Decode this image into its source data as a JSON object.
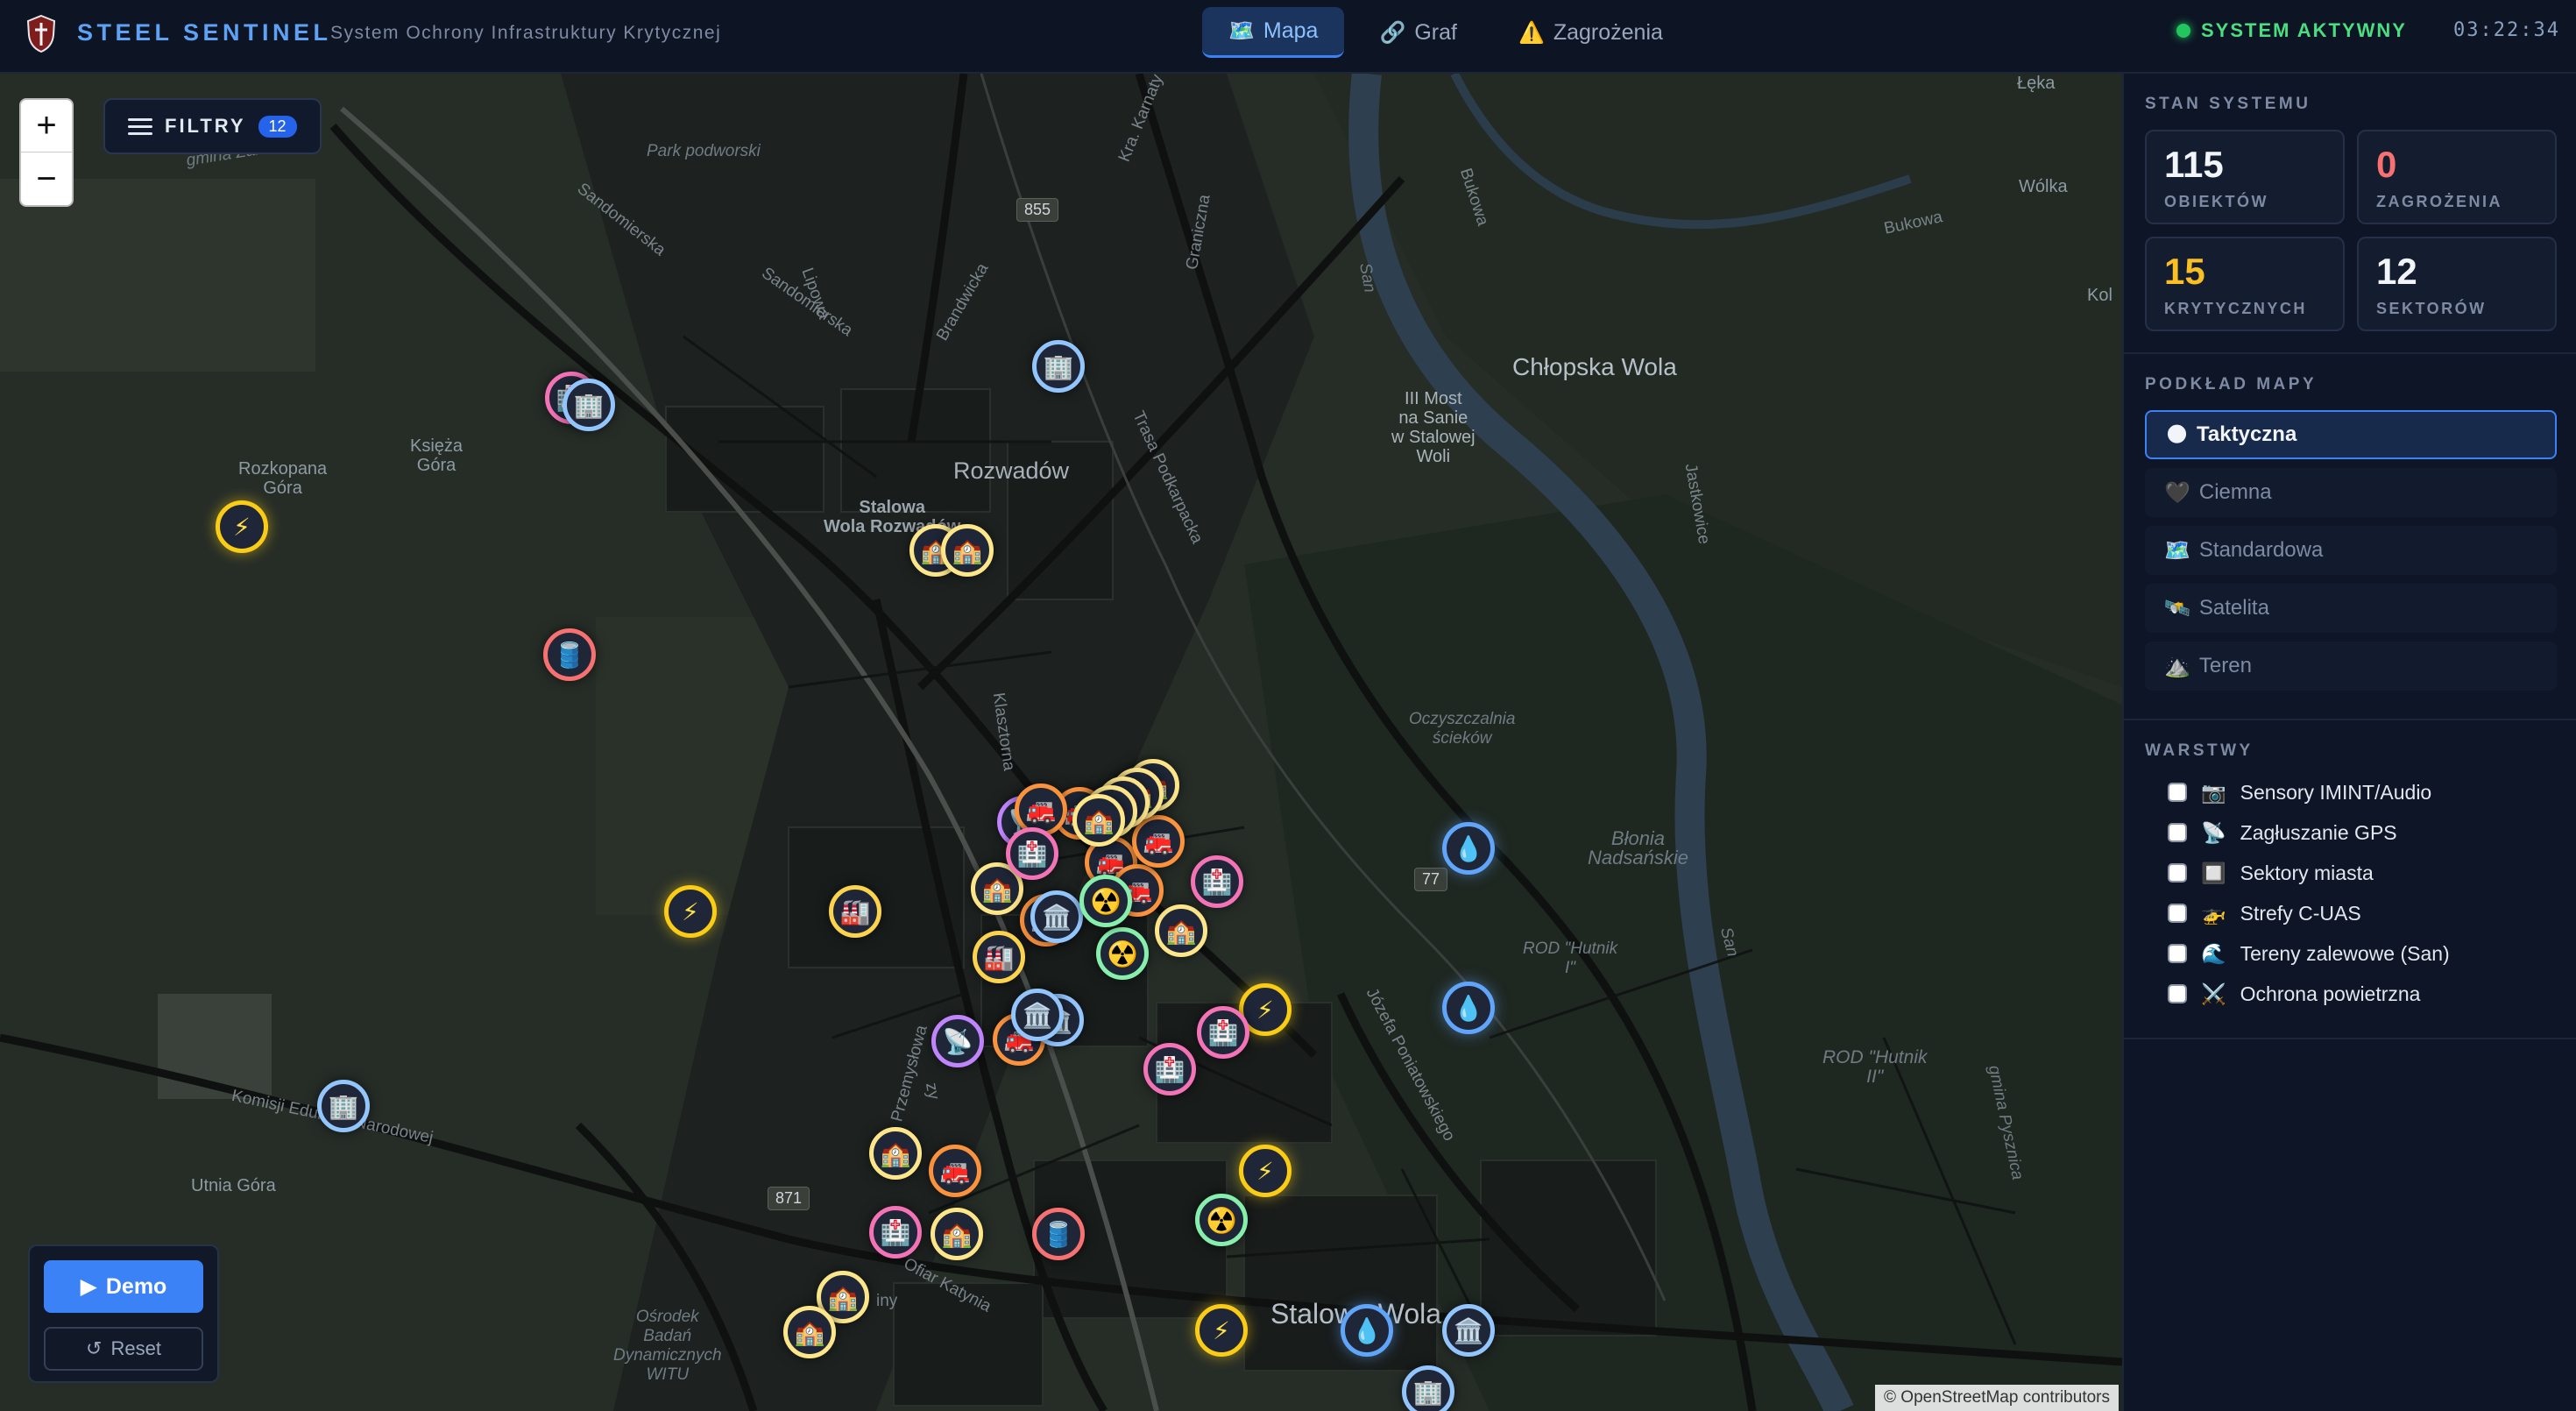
{
  "header": {
    "brand": "STEEL SENTINEL",
    "tagline": "System Ochrony Infrastruktury Krytycznej",
    "tabs": [
      {
        "icon": "🗺️",
        "label": "Mapa",
        "active": true
      },
      {
        "icon": "🔗",
        "label": "Graf",
        "active": false
      },
      {
        "icon": "⚠️",
        "label": "Zagrożenia",
        "active": false
      }
    ],
    "status_label": "SYSTEM AKTYWNY",
    "status_color": "#22c55e",
    "clock": "03:22:34"
  },
  "map": {
    "filters_label": "FILTRY",
    "filters_count": "12",
    "zoom_in": "+",
    "zoom_out": "−",
    "demo_label": "Demo",
    "demo_icon": "▶",
    "reset_label": "Reset",
    "reset_icon": "↺",
    "attribution": "© OpenStreetMap contributors",
    "labels": {
      "park": "Park podworski",
      "zaleszany": "gmina Zaleszany",
      "sandomierska1": "Sandomierska",
      "sandomierska2": "Sandomierska",
      "lipowa": "Lipowa",
      "brandwicka": "Brandwicka",
      "graniczna": "Graniczna",
      "krakowska": "Kra. Karnaty",
      "rozkopana": "Rozkopana\nGóra",
      "ksieza": "Księża\nGóra",
      "rozwadow": "Rozwadów",
      "stalowa_rozwadow": "Stalowa\nWola Rozwadów",
      "trasa": "Trasa Podkarpacka",
      "most": "III Most\nna Sanie\nw Stalowej\nWoli",
      "chlopska": "Chłopska Wola",
      "leka": "Łęka",
      "wolka": "Wólka",
      "bukowa": "Bukowa",
      "bukowa2": "Bukowa",
      "kol": "Kol",
      "san1": "San",
      "san2": "San",
      "jastkowice": "Jastkowice",
      "oczyszczalnia": "Oczyszczalnia\nścieków",
      "blonia": "Błonia\nNadsańskie",
      "rod_hutnik1": "ROD \"Hutnik\nI\"",
      "rod_hutnik2": "ROD \"Hutnik\nII\"",
      "gmina_pysznica": "gmina Pysznica",
      "klasztorna": "Klasztorna",
      "komisji": "Komisji Edukacji Narodowej",
      "utnia": "Utnia Góra",
      "przemyslowa": "Przemysłowa",
      "poniatowskiego": "Józefa Poniatowskiego",
      "osrodek": "Ośrodek\nBadań\nDynamicznych\nWITU",
      "stalowa_wola": "Stalowa Wola",
      "kar_katyn": "Ofiar Katynia",
      "zy": "zy",
      "ny": "iny"
    },
    "shields": {
      "r855": "855",
      "r77": "77",
      "r871": "871"
    },
    "markers": [
      {
        "type": "power",
        "icon": "⚡"
      },
      {
        "type": "fuel",
        "icon": "🛢️"
      },
      {
        "type": "power",
        "icon": "⚡"
      },
      {
        "type": "gov",
        "icon": "🏢"
      },
      {
        "type": "med",
        "icon": "🏥"
      },
      {
        "type": "gov",
        "icon": "🏢"
      },
      {
        "type": "gov",
        "icon": "🏢"
      },
      {
        "type": "ind",
        "icon": "🏭"
      },
      {
        "type": "water",
        "icon": "💧"
      },
      {
        "type": "water",
        "icon": "💧"
      },
      {
        "type": "power",
        "icon": "⚡"
      },
      {
        "type": "power",
        "icon": "⚡"
      },
      {
        "type": "power",
        "icon": "⚡"
      },
      {
        "type": "water",
        "icon": "💧"
      },
      {
        "type": "gov",
        "icon": "🏛️"
      },
      {
        "type": "gov",
        "icon": "🏢"
      },
      {
        "type": "comm",
        "icon": "📡"
      },
      {
        "type": "fire",
        "icon": "🚒"
      },
      {
        "type": "med",
        "icon": "🏥"
      },
      {
        "type": "med",
        "icon": "🏥"
      },
      {
        "type": "chem",
        "icon": "☢️"
      },
      {
        "type": "fuel",
        "icon": "🛢️"
      },
      {
        "type": "elev",
        "icon": "🏫"
      },
      {
        "type": "fire",
        "icon": "🚒"
      },
      {
        "type": "elev",
        "icon": "🏫"
      },
      {
        "type": "med",
        "icon": "🏥"
      },
      {
        "type": "elev",
        "icon": "🏫"
      },
      {
        "type": "elev",
        "icon": "🏫"
      },
      {
        "type": "elev",
        "icon": "🏫"
      },
      {
        "type": "elev",
        "icon": "🏫"
      },
      {
        "type": "elev",
        "icon": "🏫"
      },
      {
        "type": "fire",
        "icon": "🚒"
      },
      {
        "type": "comm",
        "icon": "📡"
      },
      {
        "type": "fire",
        "icon": "🚒"
      },
      {
        "type": "elev",
        "icon": "🏫"
      },
      {
        "type": "fire",
        "icon": "🚒"
      },
      {
        "type": "fire",
        "icon": "🚒"
      },
      {
        "type": "fire",
        "icon": "🚒"
      },
      {
        "type": "gov",
        "icon": "🏛️"
      },
      {
        "type": "gov",
        "icon": "🏛️"
      },
      {
        "type": "chem",
        "icon": "☢️"
      },
      {
        "type": "med",
        "icon": "🏥"
      },
      {
        "type": "ind",
        "icon": "🏭"
      },
      {
        "type": "fire",
        "icon": "🚒"
      },
      {
        "type": "elev",
        "icon": "🏫"
      },
      {
        "type": "elev",
        "icon": "🏫"
      },
      {
        "type": "elev",
        "icon": "🏫"
      },
      {
        "type": "elev",
        "icon": "🏫"
      },
      {
        "type": "elev",
        "icon": "🏫"
      },
      {
        "type": "gov",
        "icon": "🏛️"
      },
      {
        "type": "chem",
        "icon": "☢️"
      },
      {
        "type": "med",
        "icon": "🏥"
      }
    ]
  },
  "sidebar": {
    "stats_title": "STAN SYSTEMU",
    "stats": [
      {
        "value": "115",
        "label": "OBIEKTÓW",
        "color": "#f1f5f9"
      },
      {
        "value": "0",
        "label": "ZAGROŻENIA",
        "color": "#f87171"
      },
      {
        "value": "15",
        "label": "KRYTYCZNYCH",
        "color": "#fbbf24"
      },
      {
        "value": "12",
        "label": "SEKTORÓW",
        "color": "#f1f5f9"
      }
    ],
    "base_title": "PODKŁAD MAPY",
    "base_layers": [
      {
        "icon": "🌑",
        "label": "Taktyczna",
        "active": true
      },
      {
        "icon": "🖤",
        "label": "Ciemna",
        "active": false
      },
      {
        "icon": "🗺️",
        "label": "Standardowa",
        "active": false
      },
      {
        "icon": "🛰️",
        "label": "Satelita",
        "active": false
      },
      {
        "icon": "⛰️",
        "label": "Teren",
        "active": false
      }
    ],
    "layers_title": "WARSTWY",
    "layers": [
      {
        "icon": "📷",
        "label": "Sensory IMINT/Audio",
        "checked": false
      },
      {
        "icon": "📡",
        "label": "Zagłuszanie GPS",
        "checked": false
      },
      {
        "icon": "🔲",
        "label": "Sektory miasta",
        "checked": false
      },
      {
        "icon": "🚁",
        "label": "Strefy C-UAS",
        "checked": false
      },
      {
        "icon": "🌊",
        "label": "Tereny zalewowe (San)",
        "checked": false
      },
      {
        "icon": "⚔️",
        "label": "Ochrona powietrzna",
        "checked": false
      }
    ]
  }
}
